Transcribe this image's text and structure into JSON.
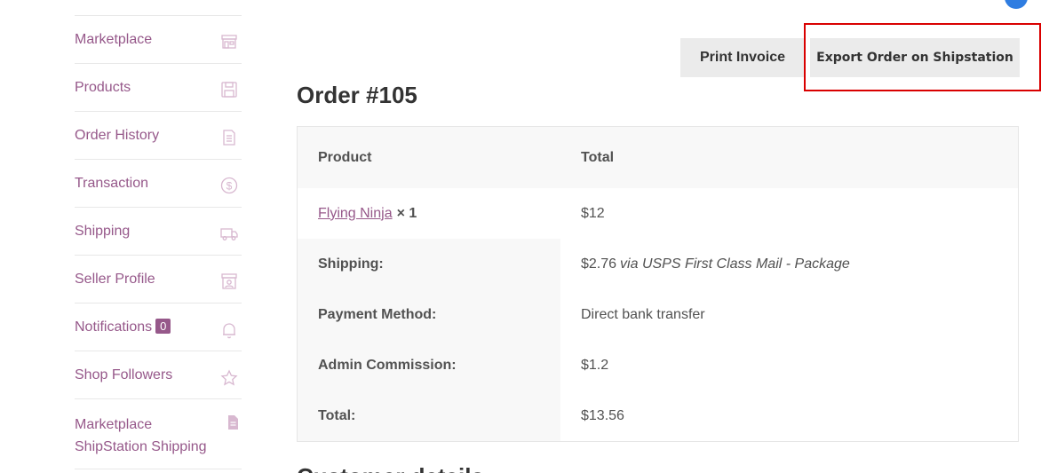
{
  "sidebar": {
    "items": [
      {
        "label": "Marketplace",
        "icon": "store-icon"
      },
      {
        "label": "Products",
        "icon": "floppy-icon"
      },
      {
        "label": "Order History",
        "icon": "document-icon"
      },
      {
        "label": "Transaction",
        "icon": "dollar-icon"
      },
      {
        "label": "Shipping",
        "icon": "truck-icon"
      },
      {
        "label": "Seller Profile",
        "icon": "profile-icon"
      },
      {
        "label": "Notifications",
        "icon": "bell-icon",
        "badge": "0"
      },
      {
        "label": "Shop Followers",
        "icon": "star-icon"
      },
      {
        "label": "Marketplace ShipStation Shipping",
        "icon": "file-icon"
      }
    ]
  },
  "actions": {
    "print_label": "Print Invoice",
    "export_label": "Export Order on Shipstation"
  },
  "order": {
    "title": "Order #105",
    "headers": {
      "product": "Product",
      "total": "Total"
    },
    "item": {
      "name": "Flying Ninja",
      "qty": "× 1",
      "total": "$12"
    },
    "shipping": {
      "label": "Shipping:",
      "amount": "$2.76",
      "method": "via USPS First Class Mail - Package"
    },
    "payment": {
      "label": "Payment Method:",
      "value": "Direct bank transfer"
    },
    "commission": {
      "label": "Admin Commission:",
      "value": "$1.2"
    },
    "total": {
      "label": "Total:",
      "value": "$13.56"
    }
  },
  "next_heading": "Customer details",
  "colors": {
    "accent": "#96588a",
    "highlight": "#d90000",
    "button_bg": "#ebebeb"
  }
}
